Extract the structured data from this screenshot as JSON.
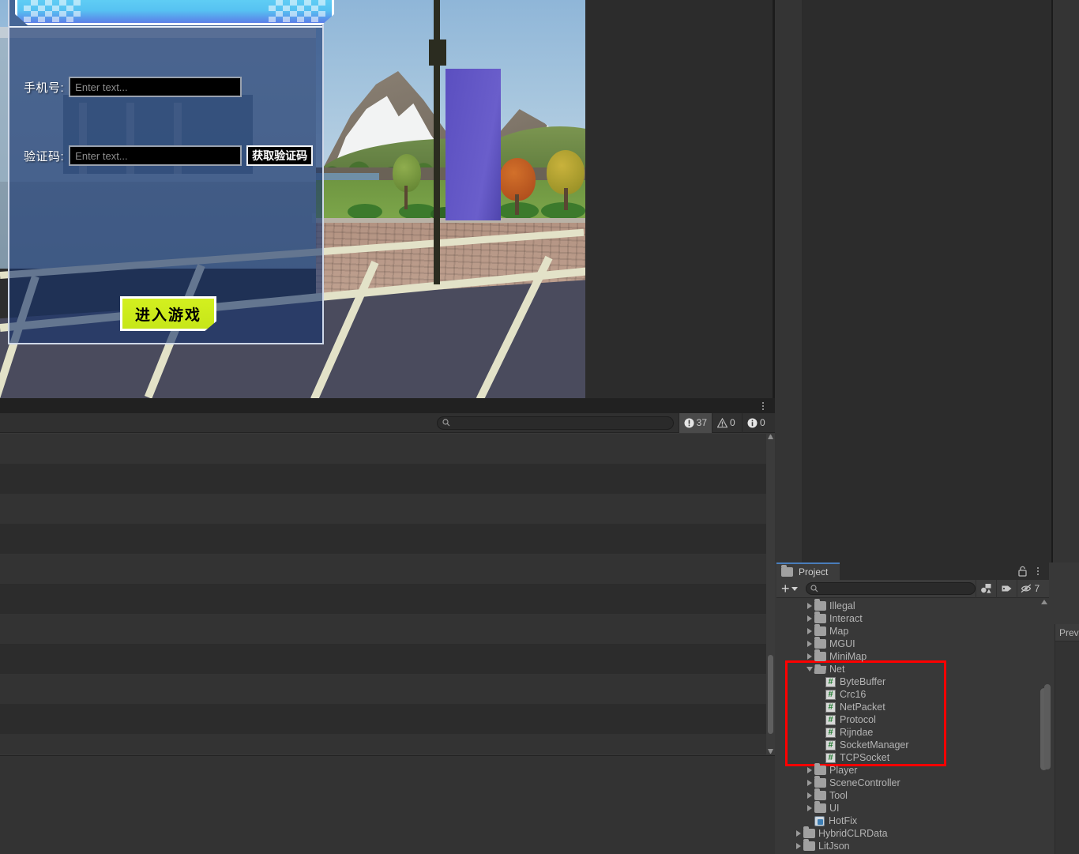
{
  "game": {
    "login_dialog": {
      "title": "",
      "fields": [
        {
          "label": "手机号:",
          "value": "",
          "placeholder": "Enter text..."
        },
        {
          "label": "验证码:",
          "value": "",
          "placeholder": "Enter text..."
        }
      ],
      "get_code_button": "获取验证码",
      "enter_game_button": "进入游戏"
    },
    "scene_description": "3D outdoor school plaza scene with snowy mountains, trees, lamp post, purple banner and road crosswalk"
  },
  "console": {
    "search": {
      "value": "",
      "placeholder": ""
    },
    "counters": {
      "error_label": "37",
      "warning_label": "0",
      "info_label": "0"
    },
    "icons": {
      "search": "search-icon",
      "error": "error-icon",
      "warning": "warning-icon",
      "info": "info-icon",
      "kebab": "kebab-menu-icon"
    },
    "rows": []
  },
  "project": {
    "tab_label": "Project",
    "tab_icon": "folder-icon",
    "lock_icon": "lock-icon",
    "kebab_icon": "kebab-menu-icon",
    "add_button": {
      "label": "+",
      "icon": "plus-icon",
      "caret": "chevron-down-icon"
    },
    "search": {
      "value": "",
      "placeholder": ""
    },
    "filters": [
      {
        "name": "filter-by-type",
        "icon": "shape-filter-icon"
      },
      {
        "name": "filter-by-label",
        "icon": "tag-icon"
      }
    ],
    "hidden_items": {
      "count": "7",
      "icon": "eye-slash-icon"
    },
    "tree": [
      {
        "name": "Illegal",
        "icon": "folder-icon",
        "indent": 2,
        "expandable": true,
        "expanded": false,
        "highlighted": false
      },
      {
        "name": "Interact",
        "icon": "folder-icon",
        "indent": 2,
        "expandable": true,
        "expanded": false,
        "highlighted": false
      },
      {
        "name": "Map",
        "icon": "folder-icon",
        "indent": 2,
        "expandable": true,
        "expanded": false,
        "highlighted": false
      },
      {
        "name": "MGUI",
        "icon": "folder-icon",
        "indent": 2,
        "expandable": true,
        "expanded": false,
        "highlighted": false
      },
      {
        "name": "MiniMap",
        "icon": "folder-icon",
        "indent": 2,
        "expandable": true,
        "expanded": false,
        "highlighted": false
      },
      {
        "name": "Net",
        "icon": "folder-open-icon",
        "indent": 2,
        "expandable": true,
        "expanded": true,
        "highlighted": true
      },
      {
        "name": "ByteBuffer",
        "icon": "csharp-script-icon",
        "indent": 3,
        "expandable": false,
        "expanded": false,
        "highlighted": true
      },
      {
        "name": "Crc16",
        "icon": "csharp-script-icon",
        "indent": 3,
        "expandable": false,
        "expanded": false,
        "highlighted": true
      },
      {
        "name": "NetPacket",
        "icon": "csharp-script-icon",
        "indent": 3,
        "expandable": false,
        "expanded": false,
        "highlighted": true
      },
      {
        "name": "Protocol",
        "icon": "csharp-script-icon",
        "indent": 3,
        "expandable": false,
        "expanded": false,
        "highlighted": true
      },
      {
        "name": "Rijndae",
        "icon": "csharp-script-icon",
        "indent": 3,
        "expandable": false,
        "expanded": false,
        "highlighted": true
      },
      {
        "name": "SocketManager",
        "icon": "csharp-script-icon",
        "indent": 3,
        "expandable": false,
        "expanded": false,
        "highlighted": true
      },
      {
        "name": "TCPSocket",
        "icon": "csharp-script-icon",
        "indent": 3,
        "expandable": false,
        "expanded": false,
        "highlighted": true
      },
      {
        "name": "Player",
        "icon": "folder-icon",
        "indent": 2,
        "expandable": true,
        "expanded": false,
        "highlighted": false
      },
      {
        "name": "SceneController",
        "icon": "folder-icon",
        "indent": 2,
        "expandable": true,
        "expanded": false,
        "highlighted": false
      },
      {
        "name": "Tool",
        "icon": "folder-icon",
        "indent": 2,
        "expandable": true,
        "expanded": false,
        "highlighted": false
      },
      {
        "name": "UI",
        "icon": "folder-icon",
        "indent": 2,
        "expandable": true,
        "expanded": false,
        "highlighted": false
      },
      {
        "name": "HotFix",
        "icon": "asmdef-icon",
        "indent": 2,
        "expandable": false,
        "expanded": false,
        "highlighted": false
      },
      {
        "name": "HybridCLRData",
        "icon": "folder-icon",
        "indent": 1,
        "expandable": true,
        "expanded": false,
        "highlighted": false
      },
      {
        "name": "LitJson",
        "icon": "folder-icon",
        "indent": 1,
        "expandable": true,
        "expanded": false,
        "highlighted": false
      }
    ]
  },
  "preview": {
    "tab_label": "Preview"
  },
  "colors": {
    "accent_blue": "#4a7dbb",
    "highlight_red": "#ff0000",
    "script_green": "#1f7a2e",
    "button_yellow": "#d3f01f",
    "dialog_blue": "#16346e",
    "title_cyan": "#5fcdf4"
  }
}
